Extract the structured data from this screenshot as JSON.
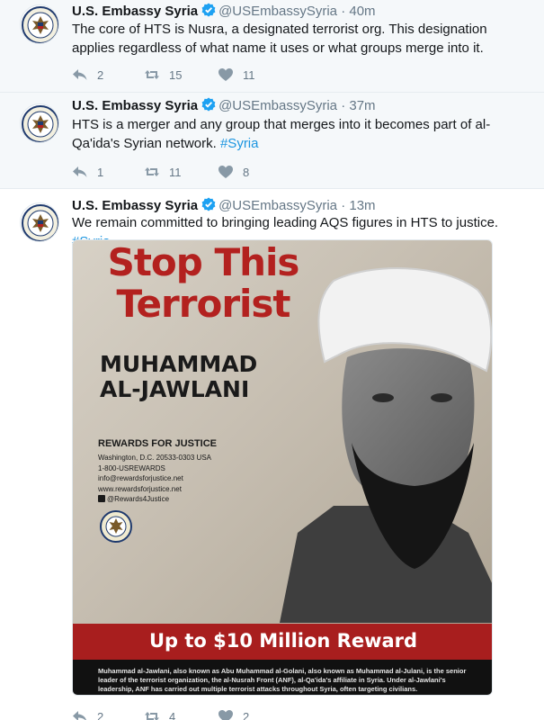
{
  "account": {
    "name": "U.S. Embassy Syria",
    "handle": "@USEmbassySyria",
    "separator": "·"
  },
  "tweets": [
    {
      "time": "40m",
      "text": "The core of HTS is Nusra, a designated terrorist org. This designation applies regardless of what name it uses or what groups merge into it.",
      "hashtag": "",
      "replies": "2",
      "retweets": "15",
      "likes": "11"
    },
    {
      "time": "37m",
      "text": "HTS is a merger and any group that merges into it becomes part of al-Qa'ida's Syrian network. ",
      "hashtag": "#Syria",
      "replies": "1",
      "retweets": "11",
      "likes": "8"
    },
    {
      "time": "13m",
      "text": "We remain committed to bringing leading AQS figures in HTS to justice. ",
      "hashtag": "#Syria",
      "replies": "2",
      "retweets": "4",
      "likes": "2"
    }
  ],
  "poster": {
    "title_line1": "Stop This",
    "title_line2": "Terrorist",
    "name_line1": "MUHAMMAD",
    "name_line2": "AL-JAWLANI",
    "program": "REWARDS FOR JUSTICE",
    "contact": [
      "Washington, D.C. 20533-0303 USA",
      "1-800-USREWARDS",
      "info@rewardsforjustice.net",
      "www.rewardsforjustice.net",
      "@Rewards4Justice"
    ],
    "reward": "Up to $10 Million Reward",
    "description": "Muhammad al-Jawlani, also known as Abu Muhammad al-Golani, also known as Muhammad al-Julani, is the senior leader of the terrorist organization, the al-Nusrah Front (ANF), al-Qa'ida's affiliate in Syria. Under al-Jawlani's leadership, ANF has carried out multiple terrorist attacks throughout Syria, often targeting civilians."
  },
  "colors": {
    "link": "#1b95e0",
    "verified": "#1da1f2",
    "poster_red": "#b3211f",
    "reward_bar": "#a81e1e"
  },
  "icons": [
    "verified-badge-icon",
    "reply-icon",
    "retweet-icon",
    "like-icon",
    "embassy-seal-icon",
    "twitter-bird-icon"
  ]
}
